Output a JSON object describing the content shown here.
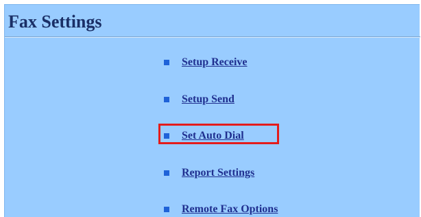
{
  "page": {
    "title": "Fax Settings"
  },
  "menu": {
    "items": [
      {
        "label": "Setup Receive"
      },
      {
        "label": "Setup Send"
      },
      {
        "label": "Set Auto Dial"
      },
      {
        "label": "Report Settings"
      },
      {
        "label": "Remote Fax Options"
      }
    ]
  },
  "colors": {
    "panel_background": "#99ccff",
    "title_text": "#1a2f66",
    "link_text": "#1f2f8f",
    "bullet": "#1f62d8",
    "highlight_box": "#e41b1b"
  },
  "icons": {
    "bullet": "square-bullet-icon"
  }
}
